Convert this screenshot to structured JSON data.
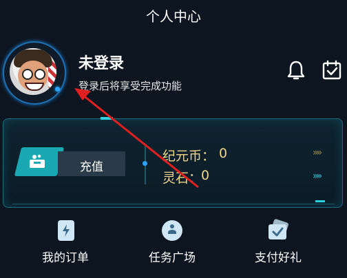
{
  "header": {
    "title": "个人中心"
  },
  "profile": {
    "login_status": "未登录",
    "login_hint": "登录后将享受完成功能"
  },
  "wallet": {
    "recharge_label": "充值",
    "coin_label": "纪元币：",
    "coin_value": "0",
    "stone_label": "灵石：",
    "stone_value": "0",
    "accent_color": "#2bd2df",
    "value_color": "#f0d48a"
  },
  "quick_actions": [
    {
      "label": "我的订单",
      "icon": "order-icon"
    },
    {
      "label": "任务广场",
      "icon": "task-icon"
    },
    {
      "label": "支付好礼",
      "icon": "gift-ticket-icon"
    }
  ],
  "icons": {
    "notification": "bell-icon",
    "checkin": "calendar-check-icon"
  },
  "annotation_color": "#e02020"
}
